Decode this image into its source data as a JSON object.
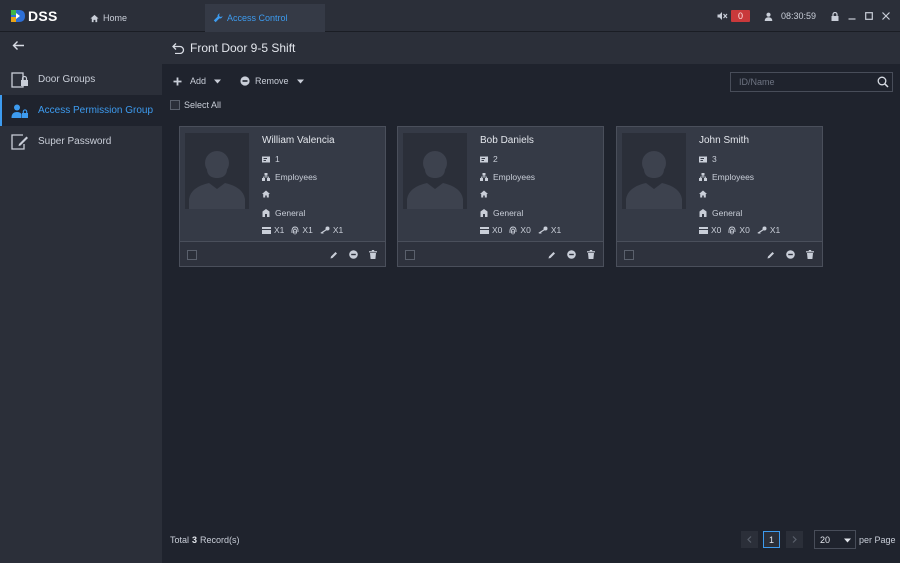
{
  "app": {
    "logo_text": "DSS",
    "tabs": [
      {
        "label": "Home"
      },
      {
        "label": "Access Control"
      }
    ],
    "alarm_count": "0",
    "time": "08:30:59"
  },
  "sidebar": {
    "items": [
      {
        "label": "Door Groups"
      },
      {
        "label": "Access Permission Group"
      },
      {
        "label": "Super Password"
      }
    ]
  },
  "main": {
    "title": "Front Door 9-5 Shift"
  },
  "toolbar": {
    "add_label": "Add",
    "remove_label": "Remove",
    "search_placeholder": "ID/Name",
    "select_all_label": "Select All"
  },
  "cards": [
    {
      "name": "William Valencia",
      "id": "1",
      "department": "Employees",
      "room": "",
      "template": "General",
      "card_count": "X1",
      "fingerprint_count": "X1",
      "password_count": "X1"
    },
    {
      "name": "Bob Daniels",
      "id": "2",
      "department": "Employees",
      "room": "",
      "template": "General",
      "card_count": "X0",
      "fingerprint_count": "X0",
      "password_count": "X1"
    },
    {
      "name": "John Smith",
      "id": "3",
      "department": "Employees",
      "room": "",
      "template": "General",
      "card_count": "X0",
      "fingerprint_count": "X0",
      "password_count": "X1"
    }
  ],
  "footer": {
    "total_prefix": "Total",
    "total_count": "3",
    "total_suffix": "Record(s)",
    "current_page": "1",
    "per_page_value": "20",
    "per_page_label": "per Page"
  },
  "colors": {
    "accent": "#3d9bef",
    "alarm": "#c9393b",
    "background": "#1f232d",
    "panel": "#2b2f39",
    "card": "#353a46"
  }
}
